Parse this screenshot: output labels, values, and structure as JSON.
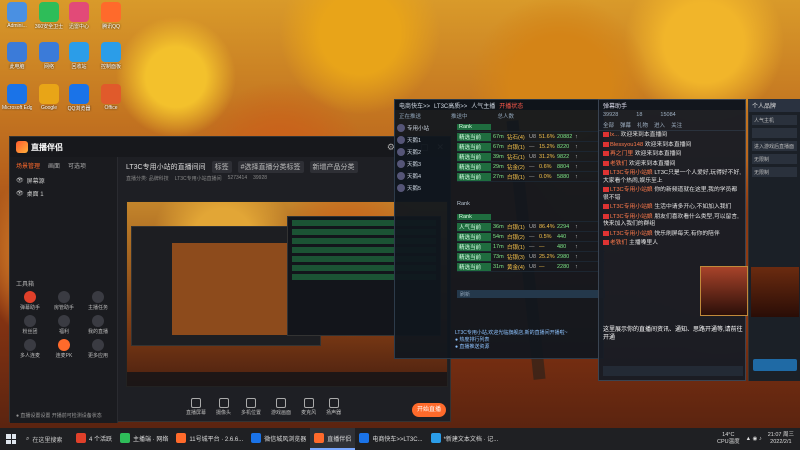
{
  "desktop": {
    "icons": [
      {
        "label": "Admini...",
        "color": "#4a90e2"
      },
      {
        "label": "360安全卫士",
        "color": "#2ebd59"
      },
      {
        "label": "迅雷中心",
        "color": "#e24a78"
      },
      {
        "label": "腾讯QQ",
        "color": "#ff6a2b"
      },
      {
        "label": "此电脑",
        "color": "#3b7bd9"
      },
      {
        "label": "网络",
        "color": "#3b7bd9"
      },
      {
        "label": "回收站",
        "color": "#2b9de8"
      },
      {
        "label": "控制面板",
        "color": "#2b9de8"
      },
      {
        "label": "Microsoft Edge",
        "color": "#1a73e8"
      },
      {
        "label": "Google",
        "color": "#e8a517"
      },
      {
        "label": "QQ浏览器",
        "color": "#1a73e8"
      },
      {
        "label": "Office",
        "color": "#e05a2b"
      }
    ]
  },
  "main_window": {
    "app_name": "直播伴侣",
    "window_controls": [
      "⚙",
      "—",
      "▢",
      "✕"
    ],
    "scene_tabs": [
      "场景管理",
      "画面",
      "可选项"
    ],
    "scenes": [
      "屏幕源",
      "桌面 1"
    ],
    "tools_header": "工具箱",
    "tools": [
      {
        "label": "弹幕助手",
        "color": "red"
      },
      {
        "label": "房管助手",
        "color": ""
      },
      {
        "label": "主播任务",
        "color": ""
      },
      {
        "label": "粉丝团",
        "color": ""
      },
      {
        "label": "福利",
        "color": ""
      },
      {
        "label": "我的直播",
        "color": ""
      },
      {
        "label": "多人连麦",
        "color": ""
      },
      {
        "label": "连麦PK",
        "color": "orange"
      },
      {
        "label": "更多应用",
        "color": ""
      }
    ],
    "bottom_note": "● 直播设置设置 开播前可检测设备状态",
    "room_title": "LT3C专用小站的直播间间",
    "room_tags": [
      "标签",
      "#选择直播分类标签",
      "新增产品分类"
    ],
    "room_meta": [
      "直播分类: 品牌科技",
      "LT3C专用小站直播间",
      "5273414",
      "39928"
    ],
    "bottom_tools": [
      "直播屏幕",
      "摄像头",
      "多机位置",
      "游戏画面",
      "麦克风",
      "扬声器"
    ],
    "start_button": "开始直播"
  },
  "monitor_panel": {
    "header": [
      "电商快车>>",
      "LT3C高质>>",
      "人气主播",
      "开播状态"
    ],
    "sub_header": [
      "正在推送",
      "推送中",
      "总人数"
    ],
    "table_head": "Rank",
    "section2_head": "Rank",
    "users": [
      "专用小站",
      "天鹅1",
      "天鹅2",
      "天鹅3",
      "天鹅4",
      "天鹅5"
    ],
    "rows_top": [
      {
        "name": "精选当前",
        "t": "67m",
        "s": "钻石(4)",
        "n": "U8",
        "p": "51.6%",
        "g": "20882",
        "k": "↑"
      },
      {
        "name": "精选当前",
        "t": "67m",
        "s": "白银(1)",
        "n": "—",
        "p": "15.2%",
        "g": "8220",
        "k": "↑"
      },
      {
        "name": "精选当前",
        "t": "39m",
        "s": "钻石(1)",
        "n": "U8",
        "p": "31.2%",
        "g": "9822",
        "k": "↑"
      },
      {
        "name": "精选当前",
        "t": "29m",
        "s": "钻金(2)",
        "n": "—",
        "p": "0.6%",
        "g": "8804",
        "k": "↑"
      },
      {
        "name": "精选当前",
        "t": "27m",
        "s": "白银(1)",
        "n": "—",
        "p": "0.0%",
        "g": "5880",
        "k": "↑"
      }
    ],
    "rows_bottom": [
      {
        "name": "人气当前",
        "t": "36m",
        "s": "白银(1)",
        "n": "U8",
        "p": "86.4%",
        "g": "2294",
        "k": "↑"
      },
      {
        "name": "精选当前",
        "t": "54m",
        "s": "白银(2)",
        "n": "—",
        "p": "0.5%",
        "g": "440",
        "k": "↑"
      },
      {
        "name": "精选当前",
        "t": "17m",
        "s": "白银(1)",
        "n": "—",
        "p": "—",
        "g": "480",
        "k": "↑"
      },
      {
        "name": "精选当前",
        "t": "73m",
        "s": "钻银(3)",
        "n": "U8",
        "p": "25.2%",
        "g": "2980",
        "k": "↑"
      },
      {
        "name": "精选当前",
        "t": "31m",
        "s": "黄金(4)",
        "n": "U8",
        "p": "—",
        "g": "2280",
        "k": "↑"
      }
    ],
    "footer_bar": "刷新",
    "log_lines": [
      "LT3C专用小站,欢迎光临旗舰店,新的直播间开播啦~",
      "● 热度排行列表",
      "● 直播推送资源"
    ]
  },
  "chat": {
    "title": "弹幕助手",
    "stats": [
      "39928",
      "18",
      "15084"
    ],
    "tabs": [
      "全部",
      "弹幕",
      "礼物",
      "进入",
      "关注"
    ],
    "messages": [
      {
        "name": "lx...",
        "text": "欢迎来到本直播间"
      },
      {
        "name": "Blessyou148",
        "text": "欢迎来到本直播间"
      },
      {
        "name": "再之门里",
        "text": "欢迎来到本直播间"
      },
      {
        "name": "老铁们",
        "text": "欢迎来到本直播间"
      },
      {
        "name": "LT3C专用小站娘",
        "text": "LT3C只是一个人爱好,玩得好不好,大家看个热闹,娱乐至上"
      },
      {
        "name": "LT3C专用小站娘",
        "text": "你的新频道就在这里,我的学员都很不错"
      },
      {
        "name": "LT3C专用小站娘",
        "text": "生活中请多开心,不如加入我们"
      },
      {
        "name": "LT3C专用小站娘",
        "text": "朋友们喜欢看什么类型,可以留言,快来加入我们的群组"
      },
      {
        "name": "LT3C专用小站娘",
        "text": "快乐刷屏每天,有你的陪伴"
      },
      {
        "name": "老铁们",
        "text": "主播嗓里人"
      }
    ],
    "notice": "这里展示你的直播间资讯、通知、思路开通等,请前往开通"
  },
  "side_panel": {
    "title": "个人品牌",
    "fields": [
      "人气主机",
      "",
      "进入游戏后直播面",
      "无限制",
      "无限制"
    ]
  },
  "taskbar": {
    "search": "在这里搜索",
    "tasks": [
      {
        "label": "4 个活跃",
        "color": "#e0402a",
        "on": false
      },
      {
        "label": "主播端 · 网络",
        "color": "#2ebd59",
        "on": false
      },
      {
        "label": "11号城平台 · 2.6.6...",
        "color": "#ff6a2b",
        "on": false
      },
      {
        "label": "微信城风浏览器",
        "color": "#1a73e8",
        "on": false
      },
      {
        "label": "直播伴侣",
        "color": "#ff6a2b",
        "on": true
      },
      {
        "label": "电商快车>>LT3C...",
        "color": "#1a73e8",
        "on": false
      },
      {
        "label": "*新建文本文档 · 记...",
        "color": "#2b9de8",
        "on": false
      }
    ],
    "weather": [
      "14°C",
      "CPU温度"
    ],
    "time": "21:07 周三",
    "date": "2022/2/1"
  }
}
